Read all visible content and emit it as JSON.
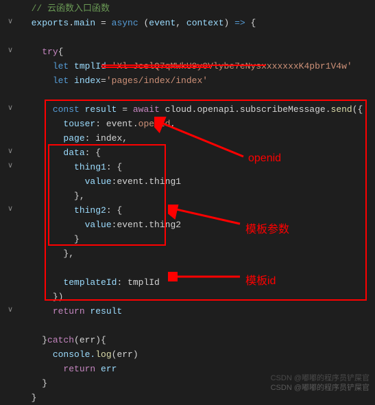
{
  "code": {
    "comment": "// 云函数入口函数",
    "line_export": "exports.main = async (event, context) => {",
    "line_try": "try{",
    "line_tmpl": "let tmplId='Xl JcelQ7qMWkU9y0Vlybe7eNysxxxxxxxK4pbr1V4w'",
    "line_tmpl_prefix": "let",
    "line_tmpl_var": " tmplId",
    "line_tmpl_eq": "=",
    "line_tmpl_str": "'Xl JcelQ7qMWkU9y0Vlybe7eNysxxxxxxxK4pbr1V4w'",
    "line_index_prefix": "let",
    "line_index_var": " index",
    "line_index_eq": "=",
    "line_index_str": "'pages/index/index'",
    "line_result_const": "const",
    "line_result_var": " result ",
    "line_result_eq": "= ",
    "line_result_await": "await",
    "line_result_call": " cloud.openapi.subscribeMessage.",
    "line_result_send": "send",
    "line_result_open": "({",
    "line_touser_key": "touser",
    "line_touser_sep": ": event.",
    "line_touser_openid": "openId",
    "line_touser_comma": ",",
    "line_page_key": "page",
    "line_page_sep": ": index,",
    "line_data_key": "data",
    "line_data_sep": ": {",
    "line_thing1_key": "thing1",
    "line_thing1_sep": ": {",
    "line_value1_key": "value",
    "line_value1_sep": ":event.thing1",
    "line_close1": "},",
    "line_thing2_key": "thing2",
    "line_thing2_sep": ": {",
    "line_value2_key": "value",
    "line_value2_sep": ":event.thing2",
    "line_close2": "}",
    "line_close_data": "},",
    "line_templateid_key": "templateId",
    "line_templateid_sep": ": tmplId",
    "line_close_send": "})",
    "line_return_result": "return",
    "line_return_result_var": " result",
    "line_catch": "}",
    "line_catch_kw": "catch",
    "line_catch_open": "(err){",
    "line_console": "console.",
    "line_console_log": "log",
    "line_console_open": "(err)",
    "line_return_err": "return",
    "line_return_err_var": " err",
    "line_close_catch": "}",
    "line_close_fn": "}"
  },
  "annotations": {
    "openid": "openid",
    "template_params": "模板参数",
    "template_id": "模板id"
  },
  "watermark": "CSDN @嘟嘟的程序员铲屎官",
  "folds": {
    "down": "∨",
    "right": "›"
  }
}
